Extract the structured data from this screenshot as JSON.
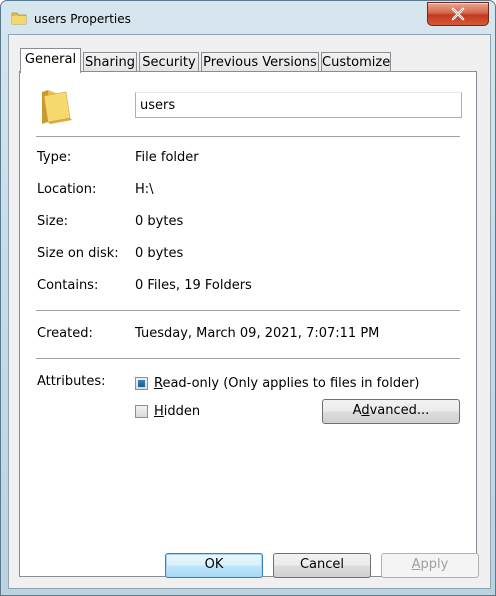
{
  "window": {
    "title": "users Properties"
  },
  "tabs": [
    {
      "label": "General",
      "active": true
    },
    {
      "label": "Sharing",
      "active": false
    },
    {
      "label": "Security",
      "active": false
    },
    {
      "label": "Previous Versions",
      "active": false
    },
    {
      "label": "Customize",
      "active": false
    }
  ],
  "general": {
    "name_value": "users",
    "rows": {
      "type": {
        "label": "Type:",
        "value": "File folder"
      },
      "location": {
        "label": "Location:",
        "value": "H:\\"
      },
      "size": {
        "label": "Size:",
        "value": "0 bytes"
      },
      "size_on_disk": {
        "label": "Size on disk:",
        "value": "0 bytes"
      },
      "contains": {
        "label": "Contains:",
        "value": "0 Files, 19 Folders"
      },
      "created": {
        "label": "Created:",
        "value": "Tuesday, March 09, 2021, 7:07:11 PM"
      }
    },
    "attributes": {
      "label": "Attributes:",
      "readonly": {
        "label_u": "R",
        "label_rest": "ead-only (Only applies to files in folder)",
        "state": "mixed"
      },
      "hidden": {
        "label_u": "H",
        "label_rest": "idden",
        "state": "unchecked"
      },
      "advanced": {
        "label_pre": "A",
        "label_u": "d",
        "label_rest": "vanced..."
      }
    }
  },
  "buttons": {
    "ok": "OK",
    "cancel": "Cancel",
    "apply_u": "A",
    "apply_rest": "pply"
  },
  "icons": {
    "title": "folder-icon",
    "close": "close-icon",
    "large_folder": "folder-icon"
  }
}
